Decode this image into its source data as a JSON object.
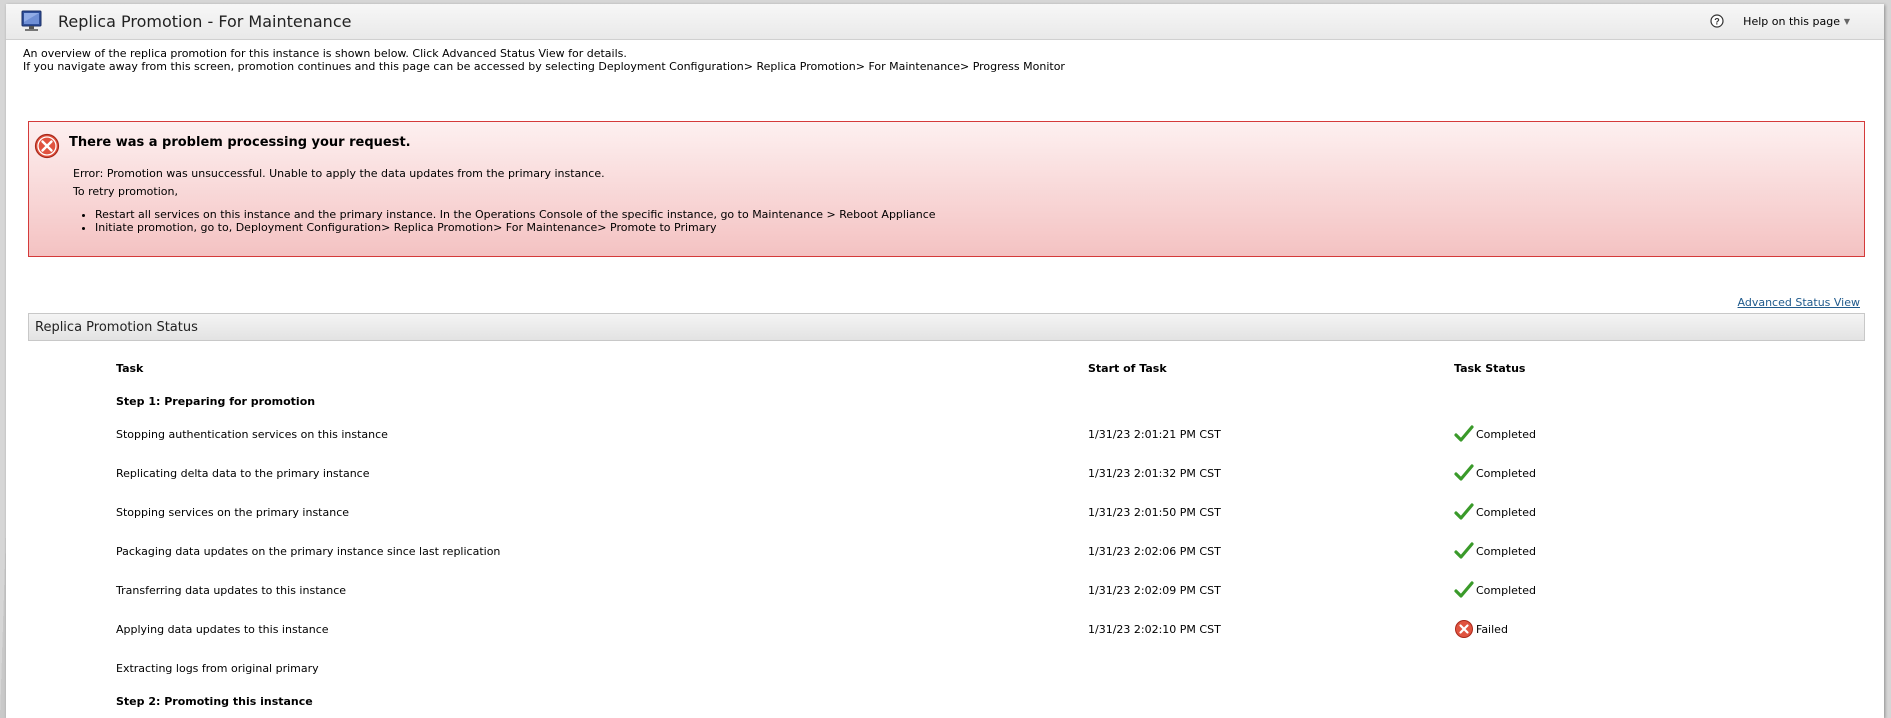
{
  "header": {
    "title": "Replica Promotion - For Maintenance",
    "help_label": "Help on this page",
    "icons": {
      "app": "monitor-icon",
      "help": "help-circle-icon",
      "caret": "chevron-down-icon"
    }
  },
  "intro": {
    "line1": "An overview of the replica promotion for this instance is shown below. Click Advanced Status View for details.",
    "line2": "If you navigate away from this screen, promotion continues and this page can be accessed by selecting Deployment Configuration> Replica Promotion> For Maintenance> Progress Monitor"
  },
  "alert": {
    "title": "There was a problem processing your request.",
    "error": "Error: Promotion was unsuccessful. Unable to apply the data updates from the primary instance.",
    "retry_label": "To retry promotion,",
    "steps": [
      "Restart all services on this instance and the primary instance. In the Operations Console of the specific instance, go to Maintenance > Reboot Appliance",
      "Initiate promotion, go to, Deployment Configuration> Replica Promotion> For Maintenance> Promote to Primary"
    ],
    "icon": "error-circle-icon",
    "colors": {
      "border": "#d43a3a",
      "background_top": "#fdf0f0",
      "background_bottom": "#f4c2c2"
    }
  },
  "advanced_link": "Advanced Status View",
  "status_panel": {
    "title": "Replica Promotion Status",
    "columns": {
      "task": "Task",
      "start": "Start of Task",
      "status": "Task Status"
    },
    "rows": [
      {
        "type": "step",
        "task": "Step 1: Preparing for promotion",
        "start": "",
        "status": ""
      },
      {
        "type": "task",
        "task": "Stopping authentication services on this instance",
        "start": "1/31/23 2:01:21 PM CST",
        "status": "Completed",
        "state": "completed"
      },
      {
        "type": "task",
        "task": "Replicating delta data to the primary instance",
        "start": "1/31/23 2:01:32 PM CST",
        "status": "Completed",
        "state": "completed"
      },
      {
        "type": "task",
        "task": "Stopping services on the primary instance",
        "start": "1/31/23 2:01:50 PM CST",
        "status": "Completed",
        "state": "completed"
      },
      {
        "type": "task",
        "task": "Packaging data updates on the primary instance since last replication",
        "start": "1/31/23 2:02:06 PM CST",
        "status": "Completed",
        "state": "completed"
      },
      {
        "type": "task",
        "task": "Transferring data updates to this instance",
        "start": "1/31/23 2:02:09 PM CST",
        "status": "Completed",
        "state": "completed"
      },
      {
        "type": "task",
        "task": "Applying data updates to this instance",
        "start": "1/31/23 2:02:10 PM CST",
        "status": "Failed",
        "state": "failed"
      },
      {
        "type": "task",
        "task": "Extracting logs from original primary",
        "start": "",
        "status": "",
        "state": "none"
      },
      {
        "type": "step",
        "task": "Step 2: Promoting this instance",
        "start": "",
        "status": ""
      }
    ],
    "colors": {
      "completed": "#3a9a2a",
      "failed": "#d9432f",
      "link": "#1f5a8c"
    }
  }
}
